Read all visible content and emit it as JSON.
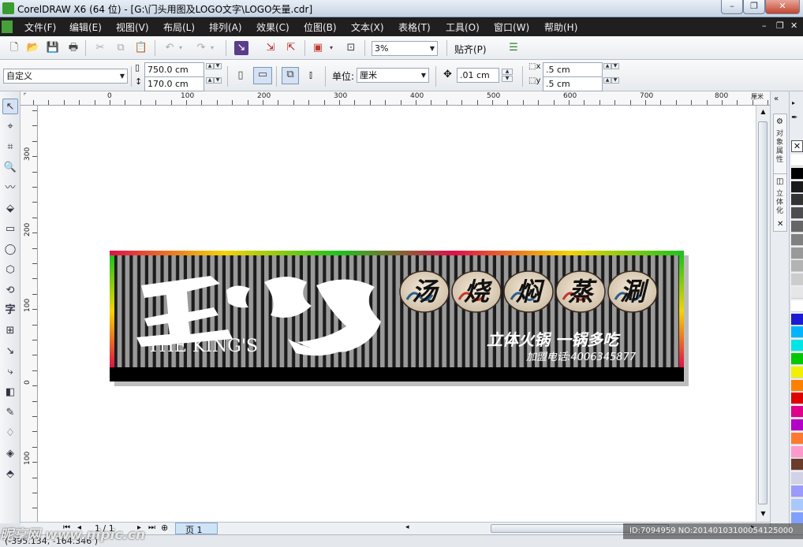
{
  "window": {
    "title": "CorelDRAW X6 (64 位) - [G:\\门头用图及LOGO文字\\LOGO矢量.cdr]",
    "minimize": "–",
    "restore": "❐",
    "close": "✕"
  },
  "menubar": {
    "items": [
      "文件(F)",
      "编辑(E)",
      "视图(V)",
      "布局(L)",
      "排列(A)",
      "效果(C)",
      "位图(B)",
      "文本(X)",
      "表格(T)",
      "工具(O)",
      "窗口(W)",
      "帮助(H)"
    ],
    "doc_controls": [
      "–",
      "❐",
      "✕"
    ]
  },
  "standard_toolbar": {
    "zoom_level": "3%",
    "snap_label": "贴齐(P)"
  },
  "property_bar": {
    "preset": "自定义",
    "page_width": "750.0 cm",
    "page_height": "170.0 cm",
    "units_label": "单位:",
    "units_value": "厘米",
    "nudge": ".01 cm",
    "dup_x": ".5 cm",
    "dup_y": ".5 cm"
  },
  "ruler": {
    "h_labels": [
      "0",
      "100",
      "200",
      "300",
      "400",
      "500",
      "600",
      "700",
      "800"
    ],
    "h_unit": "厘米",
    "v_labels": [
      "300",
      "200",
      "100",
      "0",
      "100"
    ]
  },
  "dockers": {
    "tab_object_properties": "对象属性",
    "tab_extrude": "立体化"
  },
  "palette": {
    "colors": [
      "#ffffff",
      "#000000",
      "#1a1a1a",
      "#333333",
      "#4d4d4d",
      "#666666",
      "#808080",
      "#999999",
      "#b3b3b3",
      "#cccccc",
      "#e6e6e6",
      "#ffffff",
      "#1b1bd6",
      "#00b4ff",
      "#00e6e6",
      "#00c800",
      "#f0f000",
      "#ff8000",
      "#e00000",
      "#e0008c",
      "#b400c8",
      "#ff7a30",
      "#ff99cc",
      "#6b3c2a",
      "#d2d2e6",
      "#9a9aff",
      "#a8c8ff",
      "#7fa0ff"
    ]
  },
  "page_nav": {
    "page_counter": "1 / 1",
    "page_tab": "页 1"
  },
  "status": {
    "coords": "(-395.134, -164.346 )"
  },
  "watermark": {
    "site": "昵享网 www.nipic.cn",
    "id": "ID:7094959 NO:20140103100054125000"
  },
  "artwork": {
    "logo_text_en": "THE KING'S",
    "circle_labels": [
      "汤",
      "烧",
      "焖",
      "蒸",
      "涮"
    ],
    "slogan": "立体火锅 一锅多吃",
    "hotline": "加盟电话:4006345877"
  },
  "colors": {
    "stripe_light": "#9a9a9a",
    "stripe_dark": "#1c1c1c",
    "bottom_band": "#000000",
    "accent_green": "#1ec21e",
    "accent_red": "#e0104a",
    "accent_yellow": "#f4d400"
  }
}
